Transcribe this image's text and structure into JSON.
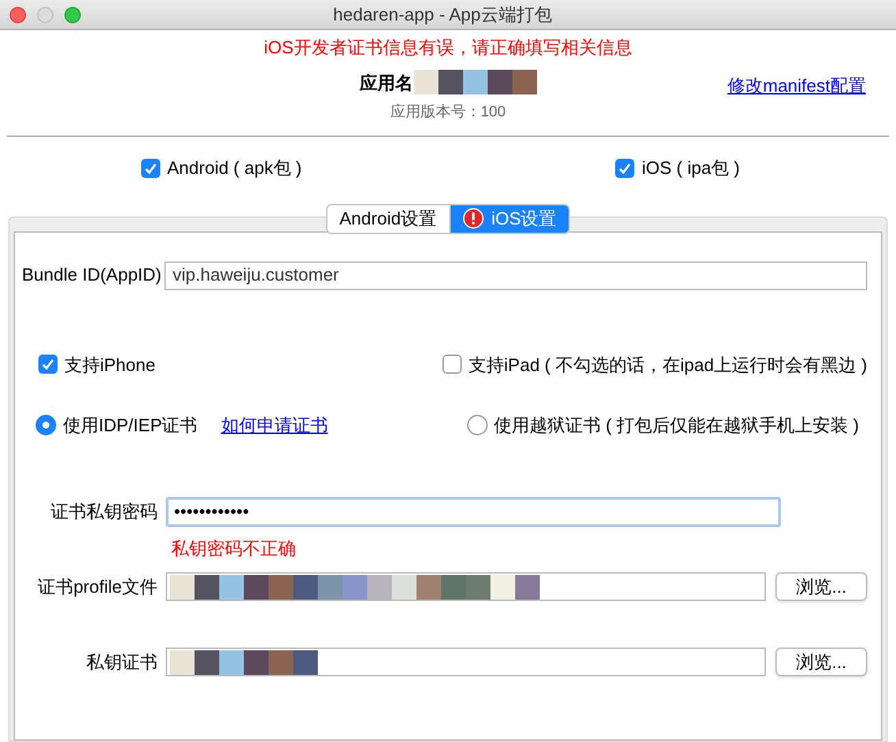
{
  "window": {
    "title": "hedaren-app - App云端打包"
  },
  "error_banner": "iOS开发者证书信息有误，请正确填写相关信息",
  "app": {
    "name": "应用名",
    "version": "应用版本号：100",
    "manifest_link": "修改manifest配置"
  },
  "platforms": [
    {
      "label": "Android ( apk包 )",
      "checked": true
    },
    {
      "label": "iOS ( ipa包 )",
      "checked": true
    }
  ],
  "tabs": [
    {
      "label": "Android设置",
      "selected": false,
      "error": false
    },
    {
      "label": "iOS设置",
      "selected": true,
      "error": true
    }
  ],
  "bundle_id": {
    "label": "Bundle ID(AppID)",
    "value": "vip.haweiju.customer"
  },
  "devices": [
    {
      "label": "支持iPhone",
      "checked": true
    },
    {
      "label": "支持iPad ( 不勾选的话，在ipad上运行时会有黑边 )",
      "checked": false
    }
  ],
  "cert_types": [
    {
      "label": "使用IDP/IEP证书",
      "selected": true,
      "link": "如何申请证书"
    },
    {
      "label": "使用越狱证书 ( 打包后仅能在越狱手机上安装 )",
      "selected": false
    }
  ],
  "password": {
    "label": "证书私钥密码",
    "value": "••••••••••••",
    "error": "私钥密码不正确"
  },
  "files": [
    {
      "label": "证书profile文件",
      "button": "浏览..."
    },
    {
      "label": "私钥证书",
      "button": "浏览..."
    }
  ]
}
